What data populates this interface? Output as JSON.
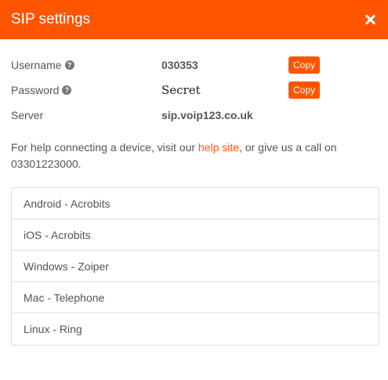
{
  "header": {
    "title": "SIP settings"
  },
  "fields": [
    {
      "label": "Username",
      "value": "030353",
      "has_help": true,
      "copy_label": "Copy"
    },
    {
      "label": "Password",
      "value": "Secret",
      "has_help": true,
      "copy_label": "Copy"
    },
    {
      "label": "Server",
      "value": "sip.voip123.co.uk",
      "has_help": false
    }
  ],
  "help": {
    "prefix": "For help connecting a device, visit our ",
    "link_text": "help site",
    "suffix": ", or give us a call on 03301223000."
  },
  "devices": [
    {
      "label": "Android - Acrobits"
    },
    {
      "label": "iOS - Acrobits"
    },
    {
      "label": "Windows - Zoiper"
    },
    {
      "label": "Mac - Telephone"
    },
    {
      "label": "Linux - Ring"
    }
  ],
  "colors": {
    "accent": "#ff5500",
    "text": "#555555",
    "border": "#dddddd"
  },
  "icons": {
    "close": "close-icon",
    "help": "question-circle-icon"
  }
}
